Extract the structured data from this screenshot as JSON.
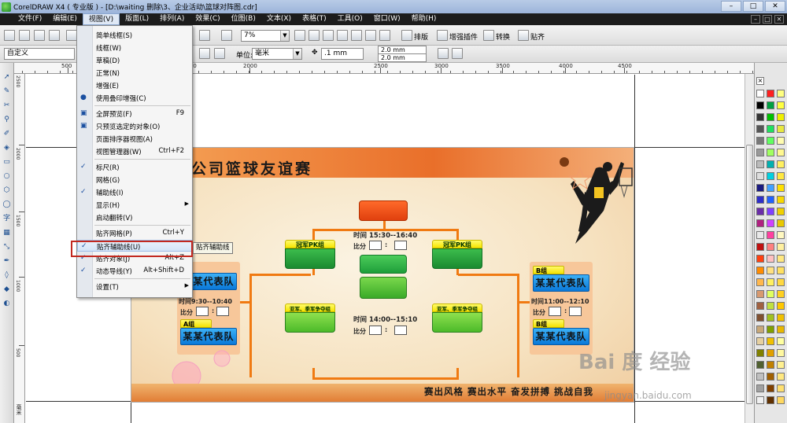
{
  "window": {
    "title": "CorelDRAW X4 ( 专业版 ) - [D:\\waiting 删除\\3、企业活动\\篮球对阵图.cdr]",
    "controls": [
      "–",
      "□",
      "✕"
    ]
  },
  "menubar": {
    "items": [
      "文件(F)",
      "编辑(E)",
      "视图(V)",
      "版面(L)",
      "排列(A)",
      "效果(C)",
      "位图(B)",
      "文本(X)",
      "表格(T)",
      "工具(O)",
      "窗口(W)",
      "帮助(H)"
    ],
    "active_index": 2,
    "doc_controls": [
      "–",
      "□",
      "✕"
    ]
  },
  "toolbar1": {
    "zoom_value": "7%",
    "buttons": [
      "排版",
      "增强插件",
      "转换",
      "贴齐"
    ]
  },
  "toolbar2": {
    "preset_value": "自定义",
    "units_label": "单位:",
    "units_value": "毫米",
    "nudge_value": ".1 mm",
    "dup_x": "2.0 mm",
    "dup_y": "2.0 mm"
  },
  "ruler": {
    "h_labels": [
      "500",
      "1000",
      "1500",
      "2000",
      "2500",
      "3000",
      "3500",
      "4000",
      "4500"
    ],
    "v_labels": [
      "2500",
      "2000",
      "1500",
      "1000",
      "500"
    ],
    "unit": "毫米"
  },
  "view_menu": {
    "items": [
      {
        "label": "简单线框(S)",
        "shortcut": "",
        "check": "",
        "submenu": false
      },
      {
        "label": "线框(W)",
        "shortcut": "",
        "check": "",
        "submenu": false
      },
      {
        "label": "草稿(D)",
        "shortcut": "",
        "check": "",
        "submenu": false
      },
      {
        "label": "正常(N)",
        "shortcut": "",
        "check": "",
        "submenu": false
      },
      {
        "label": "增强(E)",
        "shortcut": "",
        "check": "",
        "submenu": false
      },
      {
        "label": "使用叠印增强(C)",
        "shortcut": "",
        "check": "●",
        "submenu": false
      },
      {
        "label": "全屏预览(F)",
        "shortcut": "F9",
        "check": "▣",
        "submenu": false
      },
      {
        "label": "只预览选定的对象(O)",
        "shortcut": "",
        "check": "▣",
        "submenu": false
      },
      {
        "label": "页面排序器视图(A)",
        "shortcut": "",
        "check": "",
        "submenu": false
      },
      {
        "label": "视图管理器(W)",
        "shortcut": "Ctrl+F2",
        "check": "",
        "submenu": false
      },
      {
        "label": "标尺(R)",
        "shortcut": "",
        "check": "✓",
        "submenu": false
      },
      {
        "label": "网格(G)",
        "shortcut": "",
        "check": "",
        "submenu": false
      },
      {
        "label": "辅助线(I)",
        "shortcut": "",
        "check": "✓",
        "submenu": false
      },
      {
        "label": "显示(H)",
        "shortcut": "",
        "check": "",
        "submenu": true
      },
      {
        "label": "启动翻转(V)",
        "shortcut": "",
        "check": "",
        "submenu": false
      },
      {
        "label": "贴齐网格(P)",
        "shortcut": "Ctrl+Y",
        "check": "",
        "submenu": false
      },
      {
        "label": "贴齐辅助线(U)",
        "shortcut": "",
        "check": "✓",
        "submenu": false
      },
      {
        "label": "贴齐对象(J)",
        "shortcut": "Alt+Z",
        "check": "✓",
        "submenu": false
      },
      {
        "label": "动态导线(Y)",
        "shortcut": "Alt+Shift+D",
        "check": "✓",
        "submenu": false
      },
      {
        "label": "设置(T)",
        "shortcut": "",
        "check": "",
        "submenu": true
      }
    ],
    "highlighted_index": 16,
    "tooltip": "贴齐辅助线"
  },
  "artwork": {
    "title": "公司篮球友谊赛",
    "slogan": "赛出风格  赛出水平  奋发拼搏  挑战自我",
    "match_top_time": "时间 15:30--16:40",
    "match_top_score": "比分",
    "match_bottom_time": "时间 14:00--15:10",
    "match_bottom_score": "比分",
    "left_top_label": "冠军PK组",
    "right_top_label": "冠军PK组",
    "left_bottom_label": "亚军、季军争夺组",
    "right_bottom_label": "亚军、季军争夺组",
    "group_a_tab": "A组",
    "group_a_team": "某某代表队",
    "group_a_time": "时间9:30--10:40",
    "group_a_score": "比分",
    "group_b_tab": "B组",
    "group_b_team": "某某代表队",
    "group_b_time": "时间11:00--12:10",
    "group_b_score": "比分",
    "group_b2_tab": "B组",
    "group_b2_team": "某某代表队",
    "group_a_top_team": "某某代表队",
    "score_sep": ":"
  },
  "watermark": {
    "brand": "Bai 度 经验",
    "url": "jingyan.baidu.com"
  },
  "colors": {
    "accent_orange": "#f07a12",
    "group_green": "#1e9e3a",
    "team_blue": "#0a78d8",
    "highlight_red": "#c2281f"
  }
}
